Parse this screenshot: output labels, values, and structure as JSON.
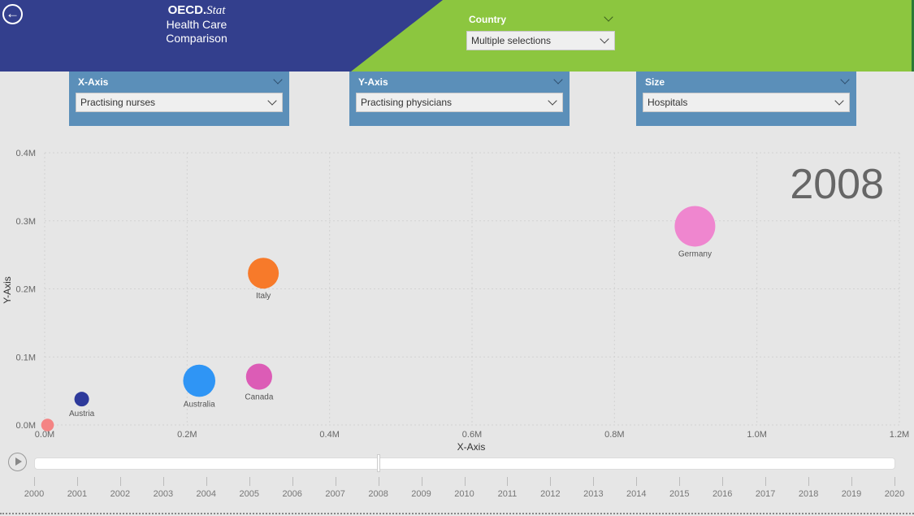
{
  "header": {
    "brand_bold": "OECD.",
    "brand_italic": "Stat",
    "subtitle_line1": "Health Care",
    "subtitle_line2": "Comparison",
    "back_icon": "back-arrow-icon"
  },
  "colors": {
    "header_blue": "#333f8d",
    "header_green": "#8cc63f",
    "panel_blue": "#5b8fb9"
  },
  "slicers": {
    "country": {
      "label": "Country",
      "value": "Multiple selections"
    },
    "x_axis": {
      "label": "X-Axis",
      "value": "Practising nurses"
    },
    "y_axis": {
      "label": "Y-Axis",
      "value": "Practising physicians"
    },
    "size": {
      "label": "Size",
      "value": "Hospitals"
    }
  },
  "timeline": {
    "current_year": "2008",
    "years": [
      "2000",
      "2001",
      "2002",
      "2003",
      "2004",
      "2005",
      "2006",
      "2007",
      "2008",
      "2009",
      "2010",
      "2011",
      "2012",
      "2013",
      "2014",
      "2015",
      "2016",
      "2017",
      "2018",
      "2019",
      "2020"
    ]
  },
  "chart_data": {
    "type": "scatter",
    "xlabel": "X-Axis",
    "ylabel": "Y-Axis",
    "xlim": [
      0,
      1200000
    ],
    "ylim": [
      0,
      400000
    ],
    "x_ticks": [
      "0.0M",
      "0.2M",
      "0.4M",
      "0.6M",
      "0.8M",
      "1.0M",
      "1.2M"
    ],
    "y_ticks": [
      "0.0M",
      "0.1M",
      "0.2M",
      "0.3M",
      "0.4M"
    ],
    "grid": true,
    "points": [
      {
        "label": "Germany",
        "x": 913000,
        "y": 292000,
        "size": 2080,
        "color": "#ef86cf",
        "show_label": true
      },
      {
        "label": "Italy",
        "x": 307000,
        "y": 223000,
        "size": 1200,
        "color": "#f77a2a",
        "show_label": true
      },
      {
        "label": "Australia",
        "x": 217000,
        "y": 65000,
        "size": 1300,
        "color": "#2f95f5",
        "show_label": true
      },
      {
        "label": "Canada",
        "x": 301000,
        "y": 71000,
        "size": 860,
        "color": "#dc5cb6",
        "show_label": true
      },
      {
        "label": "Austria",
        "x": 52000,
        "y": 38000,
        "size": 270,
        "color": "#2e3a9b",
        "show_label": true
      },
      {
        "label": "",
        "x": 4000,
        "y": 0,
        "size": 200,
        "color": "#f48484",
        "show_label": false
      }
    ]
  }
}
